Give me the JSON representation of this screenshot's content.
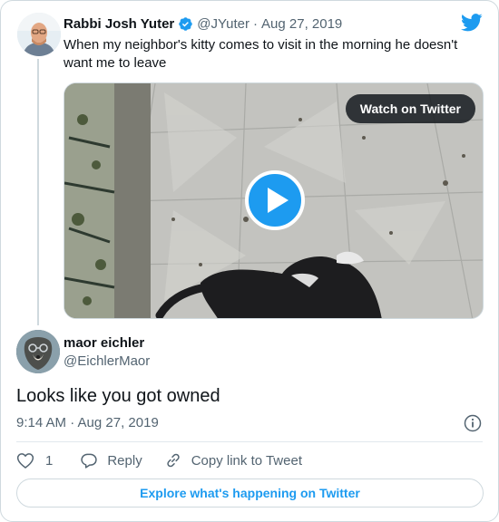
{
  "parent_tweet": {
    "author_name": "Rabbi Josh Yuter",
    "author_handle": "@JYuter",
    "separator": "·",
    "date": "Aug 27, 2019",
    "text": "When my neighbor's kitty comes to visit in the morning he doesn't want me to leave",
    "verified": true,
    "media": {
      "watch_label": "Watch on Twitter",
      "play_icon": "play-icon"
    }
  },
  "reply_tweet": {
    "author_name": "maor eichler",
    "author_handle": "@EichlerMaor",
    "text": "Looks like you got owned",
    "timestamp": "9:14 AM · Aug 27, 2019"
  },
  "actions": {
    "like_count": "1",
    "reply_label": "Reply",
    "copy_label": "Copy link to Tweet"
  },
  "explore_label": "Explore what's happening on Twitter",
  "colors": {
    "accent": "#1d9bf0",
    "text": "#0f1419",
    "secondary_text": "#536471",
    "border": "#cfd9de"
  }
}
